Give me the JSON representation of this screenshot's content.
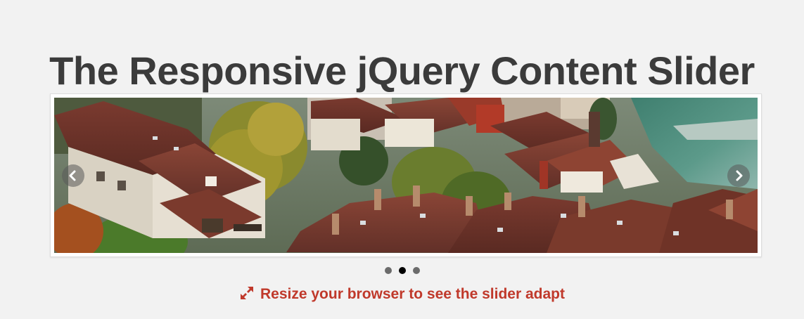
{
  "page": {
    "title": "The Responsive jQuery Content Slider",
    "caption": "Resize your browser to see the slider adapt"
  },
  "slider": {
    "slide_count": 3,
    "active_index": 1,
    "prev_label": "‹",
    "next_label": "›",
    "slide_alt": "Rooftops of an old town beside a river"
  },
  "icons": {
    "resize": "resize-arrows-icon",
    "prev": "chevron-left-icon",
    "next": "chevron-right-icon"
  },
  "colors": {
    "accent": "#c0392b",
    "title": "#3b3b3b",
    "background": "#f2f2f2",
    "dot": "#6b6b6b",
    "dot_active": "#000000"
  }
}
